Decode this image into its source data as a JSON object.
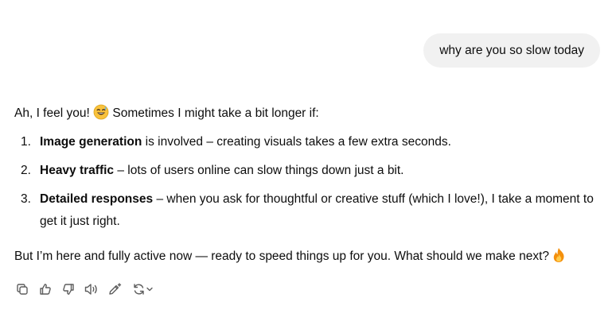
{
  "user_message": "why are you so slow today",
  "assistant": {
    "intro_before": "Ah, I feel you! ",
    "intro_emoji": "sweat-smile-emoji",
    "intro_after": " Sometimes I might take a bit longer if:",
    "items": [
      {
        "number": "1.",
        "bold": "Image generation",
        "rest": " is involved – creating visuals takes a few extra seconds."
      },
      {
        "number": "2.",
        "bold": "Heavy traffic",
        "rest": " – lots of users online can slow things down just a bit."
      },
      {
        "number": "3.",
        "bold": "Detailed responses",
        "rest": " – when you ask for thoughtful or creative stuff (which I love!), I take a moment to get it just right."
      }
    ],
    "outro": "But I’m here and fully active now — ready to speed things up for you. What should we make next? ",
    "outro_emoji": "fire-emoji"
  },
  "actions": [
    {
      "name": "copy",
      "icon": "copy-icon"
    },
    {
      "name": "thumbs-up",
      "icon": "thumbs-up-icon"
    },
    {
      "name": "thumbs-down",
      "icon": "thumbs-down-icon"
    },
    {
      "name": "read-aloud",
      "icon": "speaker-icon"
    },
    {
      "name": "edit-canvas",
      "icon": "pencil-sparkle-icon"
    },
    {
      "name": "regenerate",
      "icon": "refresh-icon"
    }
  ],
  "colors": {
    "bubble_bg": "#f1f1f1",
    "text": "#0d0d0d",
    "icon": "#5d5d5d"
  }
}
